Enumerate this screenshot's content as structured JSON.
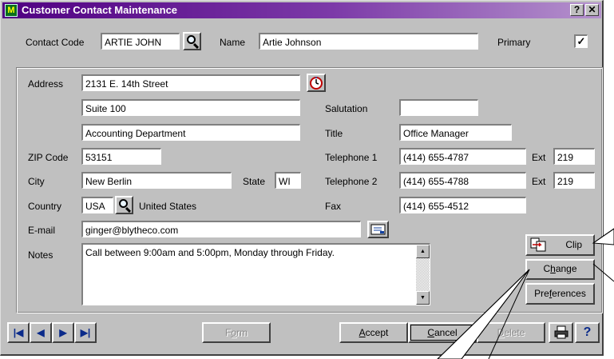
{
  "window": {
    "title": "Customer Contact Maintenance",
    "help_glyph": "?",
    "close_glyph": "✕"
  },
  "header": {
    "contact_code_label": "Contact Code",
    "contact_code_value": "ARTIE JOHN",
    "name_label": "Name",
    "name_value": "Artie Johnson",
    "primary_label": "Primary",
    "primary_checked": "✓"
  },
  "form": {
    "address_label": "Address",
    "address_line1": "2131 E. 14th Street",
    "address_line2": "Suite 100",
    "address_line3": "Accounting Department",
    "zip_label": "ZIP Code",
    "zip_value": "53151",
    "city_label": "City",
    "city_value": "New Berlin",
    "state_label": "State",
    "state_value": "WI",
    "country_label": "Country",
    "country_code": "USA",
    "country_name": "United States",
    "email_label": "E-mail",
    "email_value": "ginger@blytheco.com",
    "notes_label": "Notes",
    "notes_value": "Call between 9:00am and 5:00pm, Monday through Friday.",
    "salutation_label": "Salutation",
    "salutation_value": "",
    "title_label": "Title",
    "title_value": "Office Manager",
    "telephone1_label": "Telephone 1",
    "telephone1_value": "(414) 655-4787",
    "ext1_label": "Ext",
    "ext1_value": "219",
    "telephone2_label": "Telephone 2",
    "telephone2_value": "(414) 655-4788",
    "ext2_label": "Ext",
    "ext2_value": "219",
    "fax_label": "Fax",
    "fax_value": "(414) 655-4512"
  },
  "side_buttons": {
    "clip": "Clip",
    "change_pre": "C",
    "change_u": "h",
    "change_post": "ange",
    "preferences_pre": "Pre",
    "preferences_u": "f",
    "preferences_post": "erences"
  },
  "footer": {
    "first": "|◀",
    "prev": "◀",
    "next": "▶",
    "last": "▶|",
    "form_pre": "F",
    "form_u": "o",
    "form_post": "rm",
    "accept_u": "A",
    "accept_post": "ccept",
    "cancel_u": "C",
    "cancel_post": "ancel",
    "delete_u": "D",
    "delete_post": "elete",
    "help": "?"
  },
  "colors": {
    "title_gradient_start": "#500082",
    "window_face": "#c0c0c0"
  }
}
